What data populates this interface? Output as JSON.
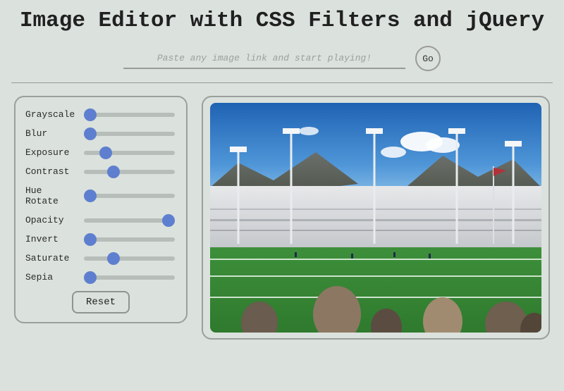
{
  "title": "Image Editor with CSS Filters and jQuery",
  "url_input": {
    "placeholder": "Paste any image link and start playing!",
    "value": ""
  },
  "go_label": "Go",
  "reset_label": "Reset",
  "filters": [
    {
      "label": "Grayscale",
      "min": 0,
      "max": 100,
      "value": 0
    },
    {
      "label": "Blur",
      "min": 0,
      "max": 100,
      "value": 0
    },
    {
      "label": "Exposure",
      "min": 0,
      "max": 100,
      "value": 20
    },
    {
      "label": "Contrast",
      "min": 0,
      "max": 100,
      "value": 30
    },
    {
      "label": "Hue Rotate",
      "min": 0,
      "max": 100,
      "value": 0
    },
    {
      "label": "Opacity",
      "min": 0,
      "max": 100,
      "value": 100
    },
    {
      "label": "Invert",
      "min": 0,
      "max": 100,
      "value": 0
    },
    {
      "label": "Saturate",
      "min": 0,
      "max": 100,
      "value": 30
    },
    {
      "label": "Sepia",
      "min": 0,
      "max": 100,
      "value": 0
    }
  ],
  "preview_image_alt": "Crowded football stadium with mountains and blue sky"
}
